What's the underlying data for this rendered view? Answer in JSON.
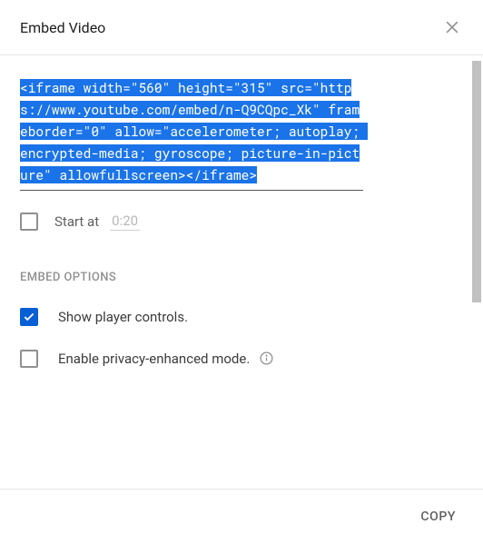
{
  "header": {
    "title": "Embed Video"
  },
  "code": "<iframe width=\"560\" height=\"315\" src=\"https://www.youtube.com/embed/n-Q9CQpc_Xk\" frameborder=\"0\" allow=\"accelerometer; autoplay; encrypted-media; gyroscope; picture-in-picture\" allowfullscreen></iframe>",
  "startAt": {
    "label": "Start at",
    "value": "0:20"
  },
  "optionsHeader": "EMBED OPTIONS",
  "options": {
    "playerControls": "Show player controls.",
    "privacy": "Enable privacy-enhanced mode."
  },
  "footer": {
    "copy": "COPY"
  }
}
